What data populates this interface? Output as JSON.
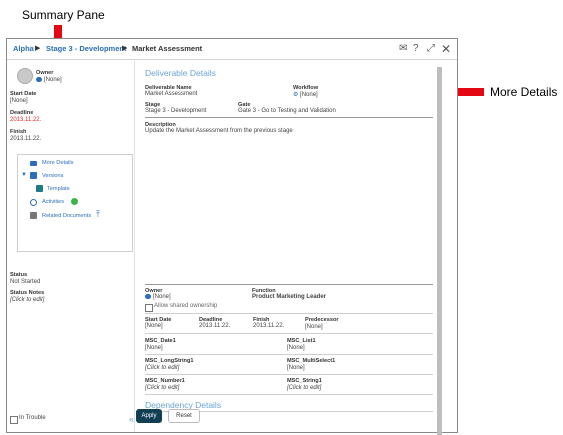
{
  "annotations": {
    "summary_pane": "Summary Pane",
    "more_details": "More Details"
  },
  "titlebar": {
    "crumb1": "Alpha",
    "crumb2": "Stage 3 - Development",
    "crumb3": "Market Assessment",
    "sep": "▶",
    "icons": [
      "mail-icon",
      "help-icon",
      "expand-icon",
      "close-icon"
    ]
  },
  "left": {
    "owner_label": "Owner",
    "owner_value": "[None]",
    "start_date_label": "Start Date",
    "start_date_value": "[None]",
    "deadline_label": "Deadline",
    "deadline_value": "2013.11.22.",
    "finish_label": "Finish",
    "finish_value": "2013.11.22.",
    "nav": {
      "more_details": "More Details",
      "versions": "Versions",
      "template": "Template",
      "activities": "Activities",
      "related_documents": "Related Documents"
    },
    "status_label": "Status",
    "status_value": "Not Started",
    "status_notes_label": "Status Notes",
    "status_notes_value": "[Click to edit]",
    "in_trouble": "In Trouble",
    "collapse": "«"
  },
  "details": {
    "section_title": "Deliverable Details",
    "deliverable_name_label": "Deliverable Name",
    "deliverable_name_value": "Market Assessment",
    "workflow_label": "Workflow",
    "workflow_value": "[None]",
    "stage_label": "Stage",
    "stage_value": "Stage 3 - Development",
    "gate_label": "Gate",
    "gate_value": "Gate 3 - Go to Testing and Validation",
    "description_label": "Description",
    "description_value": "Update the Market Assessment from the previous stage",
    "owner_label": "Owner",
    "owner_value": "[None]",
    "function_label": "Function",
    "function_value": "Product Marketing Leader",
    "allow_shared": "Allow shared ownership",
    "start_date_label": "Start Date",
    "start_date_value": "[None]",
    "deadline_label": "Deadline",
    "deadline_value": "2013.11.22.",
    "finish_label": "Finish",
    "finish_value": "2013.11.22.",
    "predecessor_label": "Predecessor",
    "predecessor_value": "[None]",
    "msc_date1_label": "MSC_Date1",
    "msc_date1_value": "[None]",
    "msc_list1_label": "MSC_List1",
    "msc_list1_value": "[None]",
    "msc_longstring1_label": "MSC_LongString1",
    "msc_longstring1_value": "[Click to edit]",
    "msc_multiselect1_label": "MSC_MultiSelect1",
    "msc_multiselect1_value": "[None]",
    "msc_number1_label": "MSC_Number1",
    "msc_number1_value": "[Click to edit]",
    "msc_string1_label": "MSC_String1",
    "msc_string1_value": "[Click to edit]",
    "dependency_title": "Dependency Details"
  },
  "buttons": {
    "apply": "Apply",
    "reset": "Reset"
  },
  "colors": {
    "accent": "#2a6ebd",
    "deadline": "#e3242b",
    "apply_bg": "#123e54",
    "annotation_arrow": "#e30613"
  }
}
